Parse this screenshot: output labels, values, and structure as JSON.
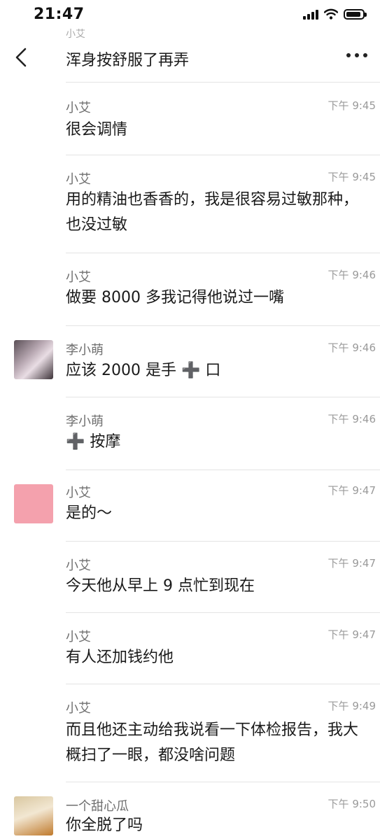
{
  "status": {
    "time": "21:47"
  },
  "header": {
    "title": "浑身按舒服了再弄",
    "clipped_name": "小艾"
  },
  "messages": [
    {
      "name": "小艾",
      "time": "下午 9:45",
      "text": "很会调情"
    },
    {
      "name": "小艾",
      "time": "下午 9:45",
      "text": "用的精油也香香的，我是很容易过敏那种，也没过敏"
    },
    {
      "name": "小艾",
      "time": "下午 9:46",
      "text": "做要 8000 多我记得他说过一嘴"
    },
    {
      "name": "李小萌",
      "time": "下午 9:46",
      "text": "应该 2000 是手 ➕ 口"
    },
    {
      "name": "李小萌",
      "time": "下午 9:46",
      "text": "➕ 按摩"
    },
    {
      "name": "小艾",
      "time": "下午 9:47",
      "text": "是的～"
    },
    {
      "name": "小艾",
      "time": "下午 9:47",
      "text": "今天他从早上 9 点忙到现在"
    },
    {
      "name": "小艾",
      "time": "下午 9:47",
      "text": "有人还加钱约他"
    },
    {
      "name": "小艾",
      "time": "下午 9:49",
      "text": "而且他还主动给我说看一下体检报告，我大概扫了一眼，都没啥问题"
    },
    {
      "name": "一个甜心瓜",
      "time": "下午 9:50",
      "text": "你全脱了吗"
    }
  ]
}
